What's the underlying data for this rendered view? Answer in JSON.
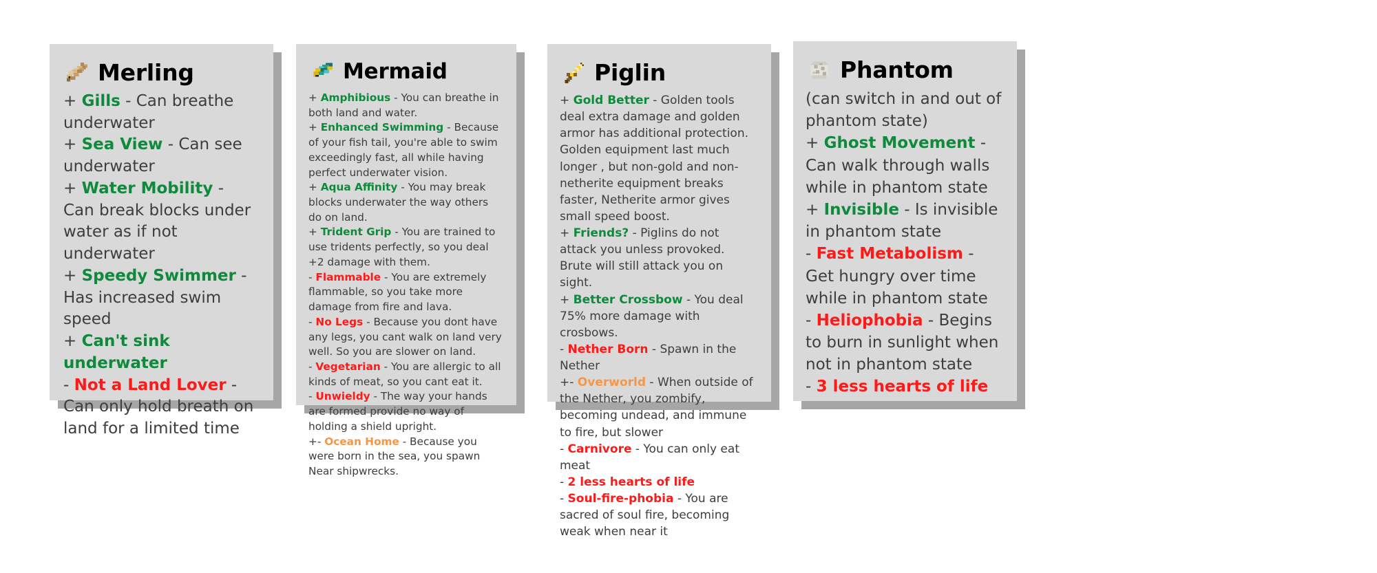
{
  "cards": [
    {
      "id": "merling",
      "title": "Merling",
      "icon": "cod-fish-icon",
      "intro": null,
      "traits": [
        {
          "sign": "+",
          "name": "Gills",
          "polarity": "pos",
          "desc": " - Can breathe underwater"
        },
        {
          "sign": "+",
          "name": "Sea View",
          "polarity": "pos",
          "desc": " - Can see underwater"
        },
        {
          "sign": "+",
          "name": "Water Mobility",
          "polarity": "pos",
          "desc": " - Can break blocks under water as if not underwater"
        },
        {
          "sign": "+",
          "name": "Speedy Swimmer",
          "polarity": "pos",
          "desc": " - Has increased swim speed"
        },
        {
          "sign": "+",
          "name": "Can't sink underwater",
          "polarity": "pos",
          "desc": ""
        },
        {
          "sign": "-",
          "name": "Not a Land Lover",
          "polarity": "neg",
          "desc": " - Can only hold breath on land for a limited time"
        }
      ]
    },
    {
      "id": "mermaid",
      "title": "Mermaid",
      "icon": "tropical-fish-icon",
      "intro": null,
      "traits": [
        {
          "sign": "+",
          "name": "Amphibious",
          "polarity": "pos",
          "desc": " - You can breathe in both land and water."
        },
        {
          "sign": "+",
          "name": "Enhanced Swimming",
          "polarity": "pos",
          "desc": " - Because of your fish tail, you're able to swim exceedingly fast, all while having perfect underwater vision."
        },
        {
          "sign": "+",
          "name": "Aqua Affinity",
          "polarity": "pos",
          "desc": " - You may break blocks underwater the way others do on land."
        },
        {
          "sign": "+",
          "name": "Trident Grip",
          "polarity": "pos",
          "desc": " - You are trained to use tridents perfectly, so you deal +2 damage with them."
        },
        {
          "sign": "-",
          "name": "Flammable",
          "polarity": "neg",
          "desc": " - You are extremely flammable, so you take more damage from fire and lava."
        },
        {
          "sign": "-",
          "name": "No Legs",
          "polarity": "neg",
          "desc": " - Because you dont have any legs, you cant walk on land very well. So you are slower on land."
        },
        {
          "sign": "-",
          "name": "Vegetarian",
          "polarity": "neg",
          "desc": " - You are allergic to all kinds of meat, so you cant eat it."
        },
        {
          "sign": "-",
          "name": "Unwieldy",
          "polarity": "neg",
          "desc": " - The way your hands are formed provide no way of holding a shield upright."
        },
        {
          "sign": "+-",
          "name": "Ocean Home",
          "polarity": "mix",
          "desc": " - Because you were born in the sea, you spawn Near shipwrecks."
        }
      ]
    },
    {
      "id": "piglin",
      "title": "Piglin",
      "icon": "golden-sword-icon",
      "intro": null,
      "traits": [
        {
          "sign": "+",
          "name": "Gold Better",
          "polarity": "pos",
          "desc": " - Golden tools deal extra damage and golden armor has additional protection. Golden equipment last much longer , but non-gold and non-netherite equipment breaks faster, Netherite armor gives small speed boost."
        },
        {
          "sign": "+",
          "name": "Friends?",
          "polarity": "pos",
          "desc": " - Piglins do not attack you unless provoked. Brute will still attack you on sight."
        },
        {
          "sign": "+",
          "name": "Better Crossbow",
          "polarity": "pos",
          "desc": " - You deal 75% more damage with crosbows."
        },
        {
          "sign": "-",
          "name": "Nether Born",
          "polarity": "neg",
          "desc": " - Spawn in the Nether"
        },
        {
          "sign": "+-",
          "name": "Overworld",
          "polarity": "mix",
          "desc": " - When outside of the Nether, you zombify, becoming undead, and immune to fire, but slower"
        },
        {
          "sign": "-",
          "name": "Carnivore",
          "polarity": "neg",
          "desc": " - You can only eat meat"
        },
        {
          "sign": "-",
          "name": "2 less hearts of life",
          "polarity": "neg",
          "desc": ""
        },
        {
          "sign": "-",
          "name": "Soul-fire-phobia",
          "polarity": "neg",
          "desc": " - You are sacred of soul fire, becoming weak when near it"
        }
      ]
    },
    {
      "id": "phantom",
      "title": "Phantom",
      "icon": "phantom-membrane-icon",
      "intro": "(can switch in and out of phantom state)",
      "traits": [
        {
          "sign": "+",
          "name": "Ghost Movement",
          "polarity": "pos",
          "desc": " - Can walk through walls while in phantom state"
        },
        {
          "sign": "+",
          "name": "Invisible",
          "polarity": "pos",
          "desc": " - Is invisible in phantom state"
        },
        {
          "sign": "-",
          "name": "Fast Metabolism",
          "polarity": "neg",
          "desc": " - Get hungry over time while in phantom state"
        },
        {
          "sign": "-",
          "name": "Heliophobia",
          "polarity": "neg",
          "desc": " - Begins to burn in sunlight when not in phantom state"
        },
        {
          "sign": "-",
          "name": "3 less hearts of life",
          "polarity": "neg",
          "desc": ""
        }
      ]
    }
  ],
  "colors": {
    "card_background": "#d9d9d9",
    "card_shadow": "#a6a6a6",
    "positive": "#0f8a3c",
    "negative": "#ff1a1a",
    "mixed": "#f79646",
    "body_text": "#3d3d3d",
    "title_text": "#000000",
    "page_background": "#ffffff"
  }
}
